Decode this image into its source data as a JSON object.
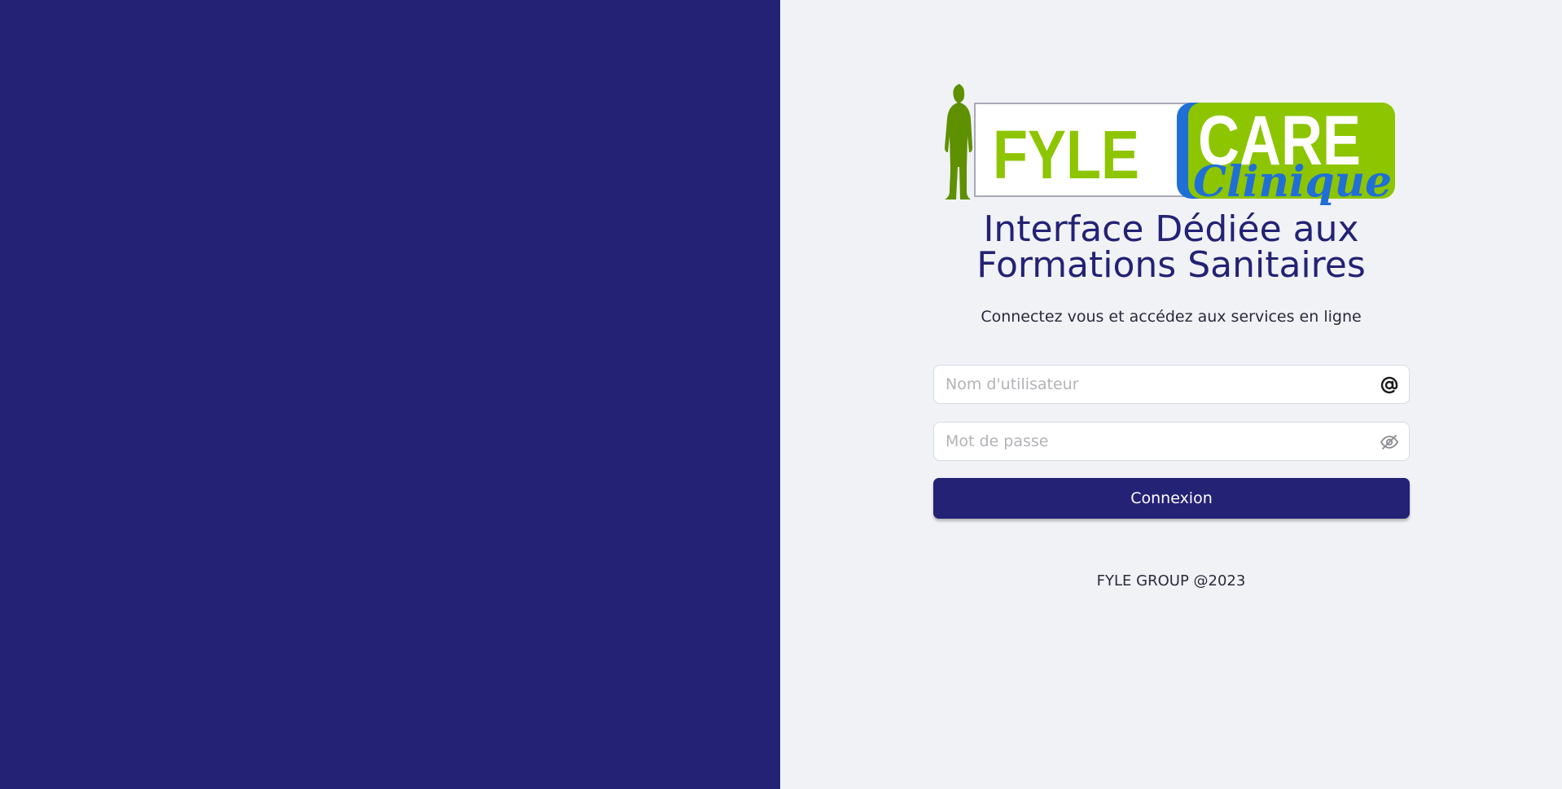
{
  "logo": {
    "brand_primary": "FYLE",
    "brand_secondary": "CARE",
    "brand_script": "Clinique",
    "colors": {
      "green": "#8dc500",
      "dark_green": "#5e9000",
      "blue": "#1f6fd6"
    }
  },
  "heading": {
    "line1": "Interface Dédiée aux",
    "line2": "Formations Sanitaires"
  },
  "subtitle": "Connectez vous et accédez aux services en ligne",
  "form": {
    "username": {
      "placeholder": "Nom d'utilisateur",
      "value": "",
      "icon": "at-icon"
    },
    "password": {
      "placeholder": "Mot de passe",
      "value": "",
      "icon": "eye-off-icon"
    },
    "submit_label": "Connexion"
  },
  "footer": "FYLE GROUP @2023",
  "colors": {
    "primary": "#232275",
    "background": "#f1f2f6"
  }
}
